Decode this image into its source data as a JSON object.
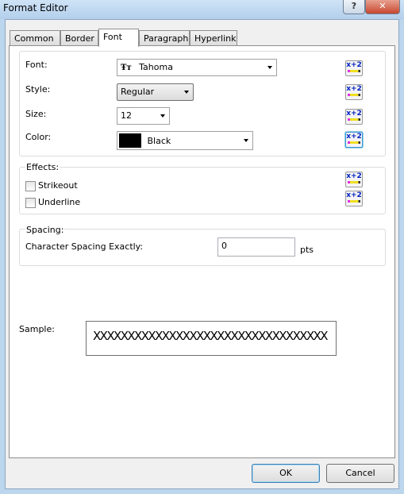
{
  "window": {
    "title": "Format Editor",
    "help_label": "?",
    "close_label": "✕"
  },
  "tabs": [
    {
      "label": "Common"
    },
    {
      "label": "Border"
    },
    {
      "label": "Font"
    },
    {
      "label": "Paragraph"
    },
    {
      "label": "Hyperlink"
    }
  ],
  "active_tab": "Font",
  "font_group": {
    "font_label": "Font:",
    "font_value": "Tahoma",
    "font_icon": "truetype-icon",
    "font_icon_glyph": "Ŧт",
    "style_label": "Style:",
    "style_value": "Regular",
    "size_label": "Size:",
    "size_value": "12",
    "color_label": "Color:",
    "color_value": "Black",
    "color_swatch": "#000000"
  },
  "expression_button_text": "x+2",
  "effects": {
    "title": "Effects:",
    "strikeout": {
      "label": "Strikeout",
      "checked": false
    },
    "underline": {
      "label": "Underline",
      "checked": false
    }
  },
  "spacing": {
    "title": "Spacing:",
    "label": "Character Spacing Exactly:",
    "value": "0",
    "unit": "pts"
  },
  "sample": {
    "label": "Sample:",
    "text": "XXXXXXXXXXXXXXXXXXXXXXXXXXXXXXXXXX"
  },
  "buttons": {
    "ok": "OK",
    "cancel": "Cancel"
  }
}
